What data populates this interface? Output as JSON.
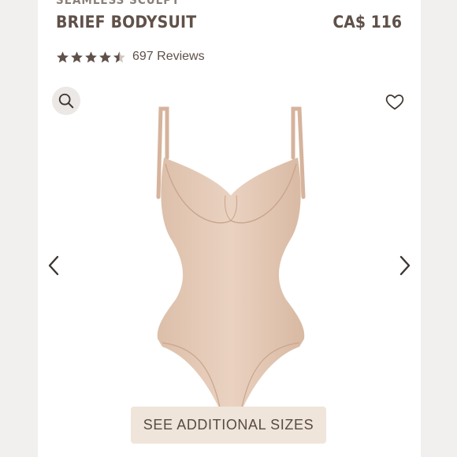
{
  "product": {
    "collection": "SEAMLESS SCULPT",
    "title": "BRIEF BODYSUIT",
    "price": "CA$ 116",
    "rating_value": 4.5,
    "reviews": "697 Reviews"
  },
  "actions": {
    "see_sizes": "SEE ADDITIONAL SIZES"
  },
  "icons": {
    "search": "search-icon",
    "wishlist": "heart-icon",
    "prev": "chevron-left-icon",
    "next": "chevron-right-icon",
    "star": "star-icon"
  },
  "colors": {
    "text": "#5f5149",
    "button_bg": "#efe5da",
    "product": "#e3c7b4"
  }
}
